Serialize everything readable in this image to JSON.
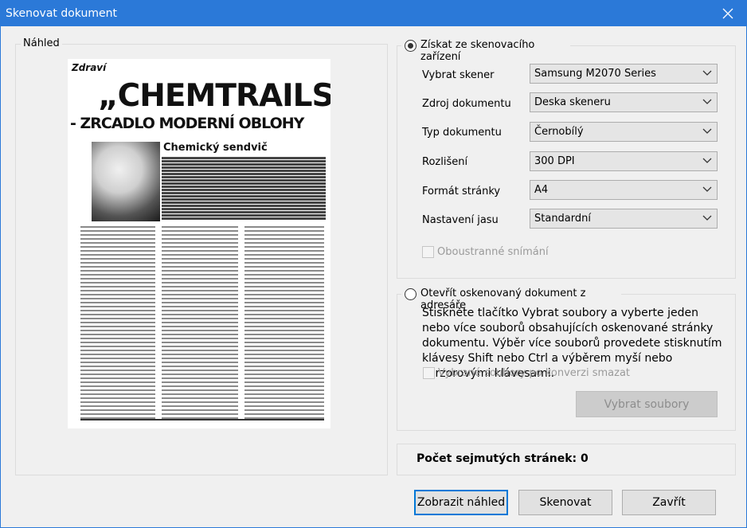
{
  "window": {
    "title": "Skenovat dokument"
  },
  "preview": {
    "legend": "Náhled",
    "page": {
      "section": "Zdraví",
      "headline": "„CHEMTRAILS“",
      "subheadline": "- ZRCADLO MODERNÍ OBLOHY",
      "article_title": "Chemický sendvič"
    }
  },
  "device_section": {
    "radio_label": "Získat ze skenovacího zařízení",
    "selected": true,
    "rows": [
      {
        "label": "Vybrat skener",
        "value": "Samsung M2070 Series"
      },
      {
        "label": "Zdroj dokumentu",
        "value": "Deska skeneru"
      },
      {
        "label": "Typ dokumentu",
        "value": "Černobílý"
      },
      {
        "label": "Rozlišení",
        "value": "300 DPI"
      },
      {
        "label": "Formát stránky",
        "value": "A4"
      },
      {
        "label": "Nastavení jasu",
        "value": "Standardní"
      }
    ],
    "duplex_label": "Oboustranné snímání"
  },
  "file_section": {
    "radio_label": "Otevřít oskenovaný dokument z adresáře",
    "selected": false,
    "description": "Stiskněte tlačítko Vybrat soubory a vyberte jeden nebo více souborů obsahujících oskenované stránky dokumentu. Výběr více souborů provedete stisknutím klávesy Shift nebo Ctrl a výběrem myší nebo kurzorovými klávesami.",
    "delete_label": "Vybrané soubory po konverzi smazat",
    "select_files_label": "Vybrat soubory"
  },
  "status": {
    "pages_label": "Počet sejmutých stránek: 0"
  },
  "buttons": {
    "preview": "Zobrazit náhled",
    "scan": "Skenovat",
    "close": "Zavřít"
  },
  "colors": {
    "titlebar": "#2b79d8",
    "focus": "#0078d7"
  }
}
